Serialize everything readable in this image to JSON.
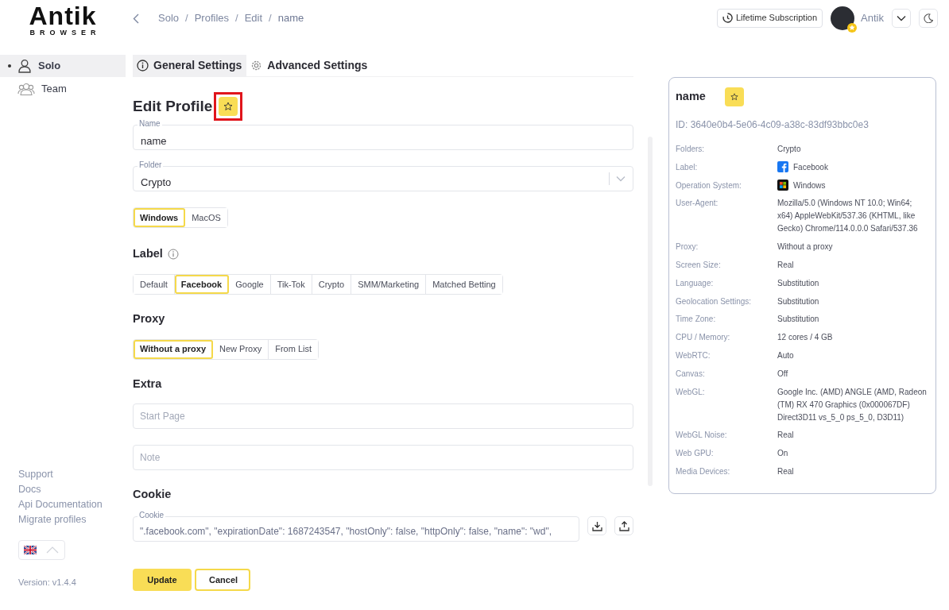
{
  "logo": {
    "word": "Antik",
    "subtitle": "BROWSER"
  },
  "breadcrumb": [
    {
      "text": "Solo",
      "kind": "link"
    },
    {
      "text": "/",
      "kind": "separator"
    },
    {
      "text": "Profiles",
      "kind": "link"
    },
    {
      "text": "/",
      "kind": "separator"
    },
    {
      "text": "Edit",
      "kind": "link"
    },
    {
      "text": "/",
      "kind": "separator"
    },
    {
      "text": "name",
      "kind": "current"
    }
  ],
  "header": {
    "subscription": "Lifetime Subscription",
    "user": "Antik"
  },
  "sidebar": {
    "items": [
      {
        "label": "Solo",
        "selected": true
      },
      {
        "label": "Team",
        "selected": false
      }
    ],
    "links": [
      "Support",
      "Docs",
      "Api Documentation",
      "Migrate profiles"
    ],
    "version": "Version: v1.4.4"
  },
  "tabs": [
    {
      "label": "General Settings",
      "selected": true
    },
    {
      "label": "Advanced Settings",
      "selected": false
    }
  ],
  "form": {
    "title": "Edit Profile",
    "favorite": {
      "highlighted": true
    },
    "name": {
      "label": "Name",
      "value": "name"
    },
    "folder": {
      "label": "Folder",
      "value": "Crypto"
    },
    "os": [
      {
        "label": "Windows",
        "selected": true
      },
      {
        "label": "MacOS",
        "selected": false
      }
    ],
    "label_heading": "Label",
    "labels": [
      {
        "label": "Default",
        "selected": false
      },
      {
        "label": "Facebook",
        "selected": true
      },
      {
        "label": "Google",
        "selected": false
      },
      {
        "label": "Tik-Tok",
        "selected": false
      },
      {
        "label": "Crypto",
        "selected": false
      },
      {
        "label": "SMM/Marketing",
        "selected": false
      },
      {
        "label": "Matched Betting",
        "selected": false
      }
    ],
    "proxy_heading": "Proxy",
    "proxy": [
      {
        "label": "Without a proxy",
        "selected": true
      },
      {
        "label": "New Proxy",
        "selected": false
      },
      {
        "label": "From List",
        "selected": false
      }
    ],
    "extra_heading": "Extra",
    "start_page": {
      "placeholder": "Start Page"
    },
    "note": {
      "placeholder": "Note"
    },
    "cookie_heading": "Cookie",
    "cookie": {
      "label": "Cookie",
      "value": "\".facebook.com\", \"expirationDate\": 1687243547, \"hostOnly\": false, \"httpOnly\": false, \"name\": \"wd\","
    },
    "buttons": [
      {
        "label": "Update",
        "kind": "primary"
      },
      {
        "label": "Cancel",
        "kind": "outline"
      }
    ]
  },
  "summary": {
    "name": "name",
    "id": "ID: 3640e0b4-5e06-4c09-a38c-83df93bbc0e3",
    "rows": [
      {
        "label": "Folders:",
        "value": "Crypto",
        "kind": "text"
      },
      {
        "label": "Label:",
        "value": "Facebook",
        "kind": "facebook"
      },
      {
        "label": "Operation System:",
        "value": "Windows",
        "kind": "windows"
      },
      {
        "label": "User-Agent:",
        "value": "Mozilla/5.0 (Windows NT 10.0; Win64; x64) AppleWebKit/537.36 (KHTML, like Gecko) Chrome/114.0.0.0 Safari/537.36",
        "kind": "text"
      },
      {
        "label": "Proxy:",
        "value": "Without a proxy",
        "kind": "text"
      },
      {
        "label": "Screen Size:",
        "value": "Real",
        "kind": "text"
      },
      {
        "label": "Language:",
        "value": "Substitution",
        "kind": "text"
      },
      {
        "label": "Geolocation Settings:",
        "value": "Substitution",
        "kind": "text"
      },
      {
        "label": "Time Zone:",
        "value": "Substitution",
        "kind": "text"
      },
      {
        "label": "CPU / Memory:",
        "value": "12 cores / 4 GB",
        "kind": "text"
      },
      {
        "label": "WebRTC:",
        "value": "Auto",
        "kind": "text"
      },
      {
        "label": "Canvas:",
        "value": "Off",
        "kind": "text"
      },
      {
        "label": "WebGL:",
        "value": "Google Inc. (AMD) ANGLE (AMD, Radeon (TM) RX 470 Graphics (0x000067DF) Direct3D11 vs_5_0 ps_5_0, D3D11)",
        "kind": "text"
      },
      {
        "label": "WebGL Noise:",
        "value": "Real",
        "kind": "text"
      },
      {
        "label": "Web GPU:",
        "value": "On",
        "kind": "text"
      },
      {
        "label": "Media Devices:",
        "value": "Real",
        "kind": "text"
      }
    ]
  }
}
